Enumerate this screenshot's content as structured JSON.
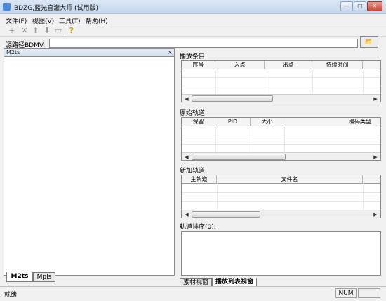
{
  "window": {
    "title": "BDZG,蓝光直灌大师 (试用版)",
    "controls": [
      "—",
      "□",
      "✕"
    ]
  },
  "menu": [
    "文件(F)",
    "视图(V)",
    "工具(T)",
    "帮助(H)"
  ],
  "toolbar": {
    "buttons": [
      {
        "icon": "plus-icon",
        "glyph": "+"
      },
      {
        "icon": "delete-icon",
        "glyph": "✕"
      },
      {
        "icon": "move-up-icon",
        "glyph": "⬆"
      },
      {
        "icon": "move-down-icon",
        "glyph": "⬇"
      },
      {
        "icon": "film-icon",
        "glyph": "▭"
      },
      {
        "icon": "help-icon",
        "glyph": "?"
      }
    ]
  },
  "source": {
    "label": "源路径BDMV:",
    "value": "",
    "browse_icon": "folder-open-icon",
    "browse_glyph": "📂"
  },
  "left_panel": {
    "header": "M2ts",
    "close": "×",
    "tabs": [
      "M2ts",
      "Mpls"
    ],
    "active_tab": "M2ts"
  },
  "playlist": {
    "label": "播放条目:",
    "columns": [
      "序号",
      "入点",
      "出点",
      "持续时间"
    ]
  },
  "original_tracks": {
    "label": "原始轨道:",
    "columns": [
      "保留",
      "PID",
      "大小",
      "编码类型"
    ]
  },
  "added_tracks": {
    "label": "新加轨道:",
    "columns": [
      "主轨道",
      "文件名"
    ]
  },
  "track_order": {
    "label": "轨道排序(0):"
  },
  "right_tabs": [
    "素材视窗",
    "播放列表视窗"
  ],
  "right_active_tab": "播放列表视窗",
  "status": {
    "text": "就绪",
    "num": "NUM"
  }
}
